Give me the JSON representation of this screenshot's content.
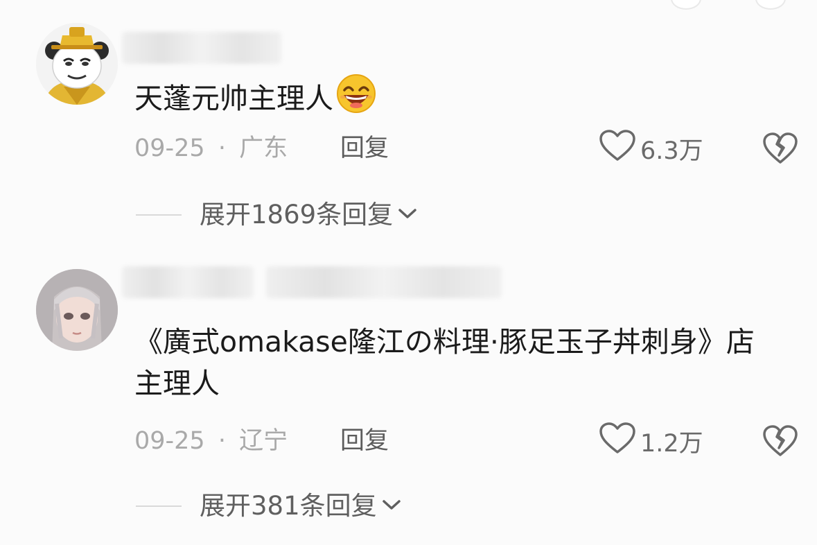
{
  "comments": [
    {
      "text": "天蓬元帅主理人",
      "date": "09-25",
      "separator": "·",
      "location": "广东",
      "reply_label": "回复",
      "likes": "6.3万",
      "expand_label": "展开1869条回复",
      "has_emoji": "grin-emoji"
    },
    {
      "text": "《廣式omakase隆江の料理·豚足玉子丼刺身》店主理人",
      "date": "09-25",
      "separator": "·",
      "location": "辽宁",
      "reply_label": "回复",
      "likes": "1.2万",
      "expand_label": "展开381条回复"
    }
  ],
  "icons": {
    "like": "heart-outline-icon",
    "dislike": "broken-heart-icon",
    "expand": "chevron-down-icon"
  },
  "colors": {
    "text": "#1b1b1b",
    "meta": "#a9a9a9",
    "action": "#5c5c5c",
    "emoji_face": "#f7c52d"
  }
}
